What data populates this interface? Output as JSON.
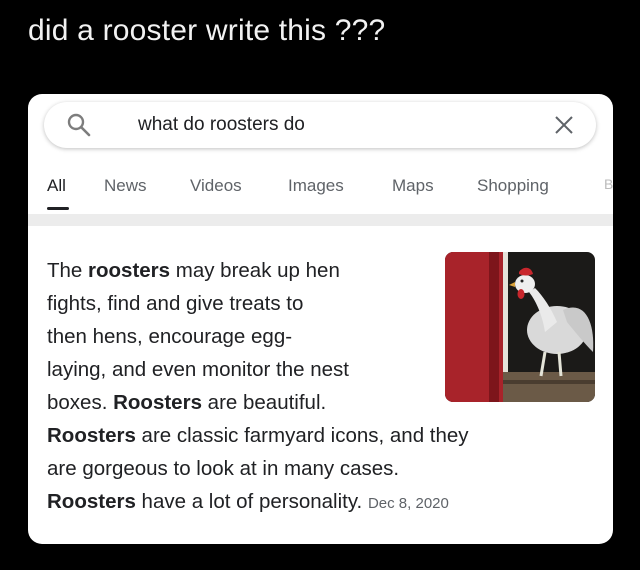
{
  "caption": "did a rooster write this ???",
  "search": {
    "query": "what do roosters do",
    "icon": "search-icon",
    "clear_icon": "close-icon"
  },
  "tabs": [
    {
      "label": "All",
      "active": true
    },
    {
      "label": "News",
      "active": false
    },
    {
      "label": "Videos",
      "active": false
    },
    {
      "label": "Images",
      "active": false
    },
    {
      "label": "Maps",
      "active": false
    },
    {
      "label": "Shopping",
      "active": false
    },
    {
      "label": "B",
      "active": false
    }
  ],
  "snippet": {
    "l1a": "The ",
    "l1b": "roosters",
    "l1c": " may break up hen",
    "l2": "fights, find and give treats to",
    "l3": "then hens, encourage egg-",
    "l4": "laying, and even monitor the nest",
    "l5a": "boxes. ",
    "l5b": "Roosters",
    "l5c": " are beautiful.",
    "l6a": "Roosters",
    "l6b": " are classic farmyard icons, and they",
    "l7": "are gorgeous to look at in many cases.",
    "l8a": "Roosters",
    "l8b": " have a lot of personality.",
    "date": "Dec 8, 2020"
  },
  "colors": {
    "background": "#000000",
    "card": "#ffffff",
    "text": "#202124",
    "muted": "#5f6368"
  }
}
